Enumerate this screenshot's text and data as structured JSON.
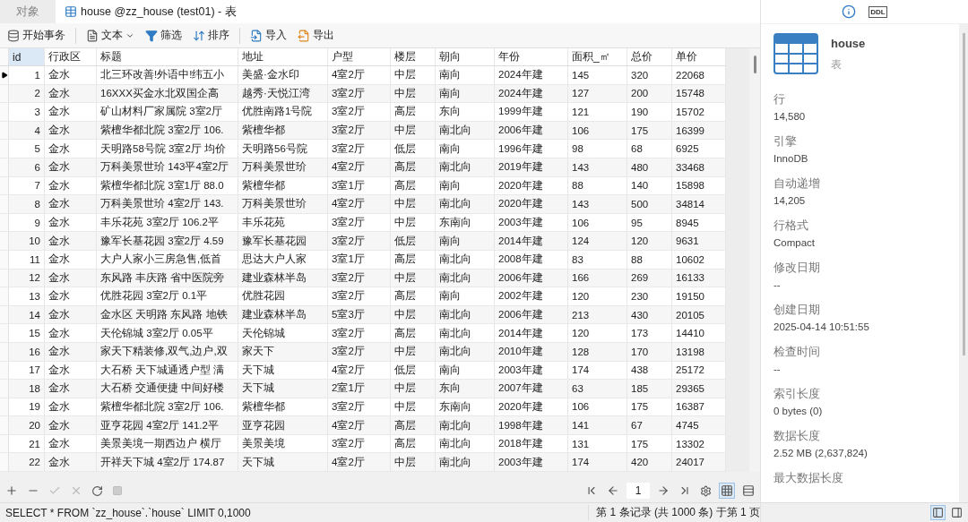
{
  "tabs": [
    {
      "label": "对象",
      "selected": false,
      "kind": "plain"
    },
    {
      "label": "house @zz_house (test01) - 表",
      "selected": true,
      "kind": "table"
    }
  ],
  "toolbar": [
    {
      "label": "开始事务",
      "kind": "transaction"
    },
    {
      "label": "文本",
      "kind": "text"
    },
    {
      "label": "筛选",
      "kind": "filter"
    },
    {
      "label": "排序",
      "kind": "sort"
    },
    {
      "label": "导入",
      "kind": "import"
    },
    {
      "label": "导出",
      "kind": "export"
    }
  ],
  "table": {
    "columns": [
      "id",
      "行政区",
      "标题",
      "地址",
      "户型",
      "楼层",
      "朝向",
      "年份",
      "面积_㎡",
      "总价",
      "单价"
    ],
    "rows": [
      {
        "selected": true,
        "cells": [
          "1",
          "金水",
          "北三环改善!外语中!纬五小",
          "美盛·金水印",
          "4室2厅",
          "中层",
          "南向",
          "2024年建",
          "145",
          "320",
          "22068"
        ]
      },
      {
        "selected": false,
        "cells": [
          "2",
          "金水",
          "16XXX买金水北双国企高",
          "越秀·天悦江湾",
          "3室2厅",
          "中层",
          "南向",
          "2024年建",
          "127",
          "200",
          "15748"
        ]
      },
      {
        "selected": false,
        "cells": [
          "3",
          "金水",
          "矿山材料厂家属院 3室2厅",
          "优胜南路1号院",
          "3室2厅",
          "高层",
          "东向",
          "1999年建",
          "121",
          "190",
          "15702"
        ]
      },
      {
        "selected": false,
        "cells": [
          "4",
          "金水",
          "紫檀华都北院 3室2厅 106.",
          "紫檀华都",
          "3室2厅",
          "中层",
          "南北向",
          "2006年建",
          "106",
          "175",
          "16399"
        ]
      },
      {
        "selected": false,
        "cells": [
          "5",
          "金水",
          "天明路58号院 3室2厅 均价",
          "天明路56号院",
          "3室2厅",
          "低层",
          "南向",
          "1996年建",
          "98",
          "68",
          "6925"
        ]
      },
      {
        "selected": false,
        "cells": [
          "6",
          "金水",
          "万科美景世玠 143平4室2厅",
          "万科美景世玠",
          "4室2厅",
          "高层",
          "南北向",
          "2019年建",
          "143",
          "480",
          "33468"
        ]
      },
      {
        "selected": false,
        "cells": [
          "7",
          "金水",
          "紫檀华都北院 3室1厅 88.0",
          "紫檀华都",
          "3室1厅",
          "高层",
          "南向",
          "2020年建",
          "88",
          "140",
          "15898"
        ]
      },
      {
        "selected": false,
        "cells": [
          "8",
          "金水",
          "万科美景世玠 4室2厅 143.",
          "万科美景世玠",
          "4室2厅",
          "中层",
          "南北向",
          "2020年建",
          "143",
          "500",
          "34814"
        ]
      },
      {
        "selected": false,
        "cells": [
          "9",
          "金水",
          "丰乐花苑 3室2厅 106.2平",
          "丰乐花苑",
          "3室2厅",
          "中层",
          "东南向",
          "2003年建",
          "106",
          "95",
          "8945"
        ]
      },
      {
        "selected": false,
        "cells": [
          "10",
          "金水",
          "豫军长基花园 3室2厅 4.59",
          "豫军长基花园",
          "3室2厅",
          "低层",
          "南向",
          "2014年建",
          "124",
          "120",
          "9631"
        ]
      },
      {
        "selected": false,
        "cells": [
          "11",
          "金水",
          "大户人家小三房急售,低首",
          "思达大户人家",
          "3室1厅",
          "高层",
          "南北向",
          "2008年建",
          "83",
          "88",
          "10602"
        ]
      },
      {
        "selected": false,
        "cells": [
          "12",
          "金水",
          "东风路 丰庆路 省中医院旁",
          "建业森林半岛",
          "3室2厅",
          "中层",
          "南北向",
          "2006年建",
          "166",
          "269",
          "16133"
        ]
      },
      {
        "selected": false,
        "cells": [
          "13",
          "金水",
          "优胜花园 3室2厅 0.1平",
          "优胜花园",
          "3室2厅",
          "高层",
          "南向",
          "2002年建",
          "120",
          "230",
          "19150"
        ]
      },
      {
        "selected": false,
        "cells": [
          "14",
          "金水",
          "金水区 天明路 东风路 地铁",
          "建业森林半岛",
          "5室3厅",
          "中层",
          "南北向",
          "2006年建",
          "213",
          "430",
          "20105"
        ]
      },
      {
        "selected": false,
        "cells": [
          "15",
          "金水",
          "天伦锦城 3室2厅 0.05平",
          "天伦锦城",
          "3室2厅",
          "高层",
          "南北向",
          "2014年建",
          "120",
          "173",
          "14410"
        ]
      },
      {
        "selected": false,
        "cells": [
          "16",
          "金水",
          "家天下精装修,双气,边户,双",
          "家天下",
          "3室2厅",
          "中层",
          "南北向",
          "2010年建",
          "128",
          "170",
          "13198"
        ]
      },
      {
        "selected": false,
        "cells": [
          "17",
          "金水",
          "大石桥 天下城通透户型 满",
          "天下城",
          "4室2厅",
          "低层",
          "南向",
          "2003年建",
          "174",
          "438",
          "25172"
        ]
      },
      {
        "selected": false,
        "cells": [
          "18",
          "金水",
          "大石桥 交通便捷 中间好楼",
          "天下城",
          "2室1厅",
          "中层",
          "东向",
          "2007年建",
          "63",
          "185",
          "29365"
        ]
      },
      {
        "selected": false,
        "cells": [
          "19",
          "金水",
          "紫檀华都北院 3室2厅 106.",
          "紫檀华都",
          "3室2厅",
          "中层",
          "东南向",
          "2020年建",
          "106",
          "175",
          "16387"
        ]
      },
      {
        "selected": false,
        "cells": [
          "20",
          "金水",
          "亚亨花园 4室2厅 141.2平",
          "亚亨花园",
          "4室2厅",
          "高层",
          "南北向",
          "1998年建",
          "141",
          "67",
          "4745"
        ]
      },
      {
        "selected": false,
        "cells": [
          "21",
          "金水",
          "美景美境一期西边户 横厅",
          "美景美境",
          "3室2厅",
          "高层",
          "南北向",
          "2018年建",
          "131",
          "175",
          "13302"
        ]
      },
      {
        "selected": false,
        "cells": [
          "22",
          "金水",
          "开祥天下城 4室2厅 174.87",
          "天下城",
          "4室2厅",
          "中层",
          "南北向",
          "2003年建",
          "174",
          "420",
          "24017"
        ]
      }
    ]
  },
  "pager": {
    "page": "1"
  },
  "view_modes": [
    {
      "kind": "grid",
      "selected": true
    },
    {
      "kind": "form",
      "selected": false
    }
  ],
  "status_bar": {
    "sql": "SELECT * FROM `zz_house`.`house` LIMIT 0,1000",
    "record": "第 1 条记录 (共 1000 条) 于第 1 页"
  },
  "panel_toggles": [
    {
      "kind": "left",
      "selected": true
    },
    {
      "kind": "right",
      "selected": false
    }
  ],
  "info_panel": {
    "ddl_label": "DDL",
    "name": "house",
    "type": "表",
    "properties": [
      {
        "label": "行",
        "value": "14,580"
      },
      {
        "label": "引擎",
        "value": "InnoDB"
      },
      {
        "label": "自动递增",
        "value": "14,205"
      },
      {
        "label": "行格式",
        "value": "Compact"
      },
      {
        "label": "修改日期",
        "value": "--"
      },
      {
        "label": "创建日期",
        "value": "2025-04-14 10:51:55"
      },
      {
        "label": "检查时间",
        "value": "--"
      },
      {
        "label": "索引长度",
        "value": "0 bytes (0)"
      },
      {
        "label": "数据长度",
        "value": "2.52 MB (2,637,824)"
      },
      {
        "label": "最大数据长度"
      }
    ]
  }
}
